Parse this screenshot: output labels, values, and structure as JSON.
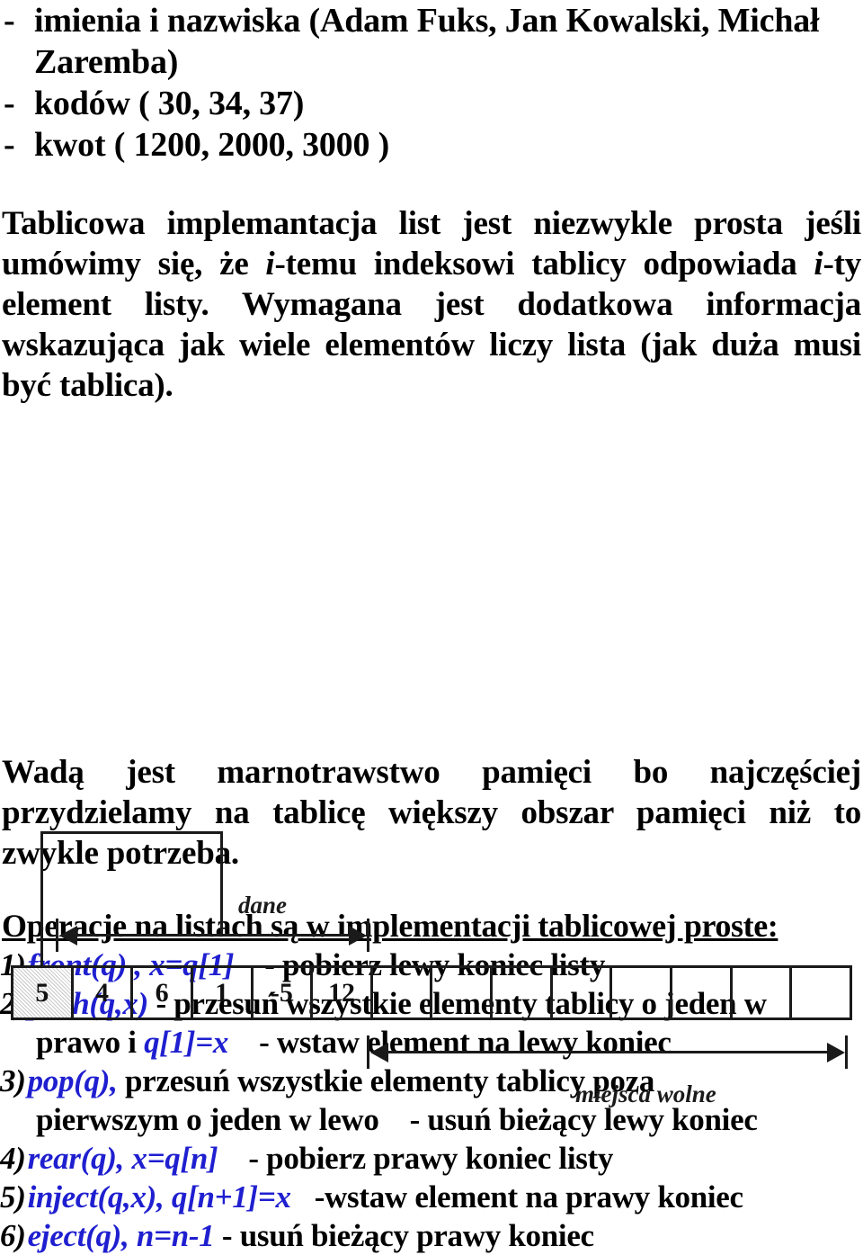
{
  "bullets": [
    {
      "dash": "-",
      "text": "imienia i nazwiska (Adam Fuks, Jan Kowalski, Michał Zaremba)"
    },
    {
      "dash": "-",
      "text": "kodów ( 30, 34, 37)"
    },
    {
      "dash": "-",
      "text": "kwot ( 1200, 2000, 3000 )"
    }
  ],
  "paragraphs": {
    "intro_part1": "Tablicowa implemantacja list jest niezwykle prosta jeśli umówimy się, że ",
    "intro_em1": "i",
    "intro_part2": "-temu indeksowi tablicy odpowiada ",
    "intro_em2": "i",
    "intro_part3": "-ty element listy. Wymagana jest dodatkowa informacja wskazująca jak wiele elementów liczy lista (jak duża musi być tablica).",
    "drawback": "Wadą jest marnotrawstwo pamięci bo najczęściej przydzielamy na tablicę większy obszar pamięci niż to zwykle potrzeba."
  },
  "figure": {
    "label_data": "dane",
    "label_free": "miejsca wolne",
    "cells": [
      {
        "value": "5",
        "shaded": true
      },
      {
        "value": "4",
        "shaded": false
      },
      {
        "value": "6",
        "shaded": false
      },
      {
        "value": "1",
        "shaded": false
      },
      {
        "value": "-5",
        "shaded": false
      },
      {
        "value": "12",
        "shaded": false
      },
      {
        "value": "",
        "shaded": false
      },
      {
        "value": "",
        "shaded": false
      },
      {
        "value": "",
        "shaded": false
      },
      {
        "value": "",
        "shaded": false
      },
      {
        "value": "",
        "shaded": false
      },
      {
        "value": "",
        "shaded": false
      },
      {
        "value": "",
        "shaded": false
      },
      {
        "value": "",
        "shaded": false
      }
    ]
  },
  "operations": {
    "title": "Operacje na listach są w implementacji tablicowej proste:",
    "accent_color": "#1f1fd0",
    "items": [
      {
        "num": "1)",
        "code": "front(q) , x=q[1]",
        "desc": "- pobierz lewy koniec listy",
        "cont_code": "",
        "cont_before": "",
        "cont_desc": ""
      },
      {
        "num": "2)",
        "code": "push(q,x)",
        "desc": "- przesuń wszystkie elementy tablicy o jeden w",
        "cont_before": "prawo i ",
        "cont_code": "q[1]=x",
        "cont_desc": "- wstaw element na lewy koniec"
      },
      {
        "num": "3)",
        "code": "pop(q),",
        "desc": "przesuń wszystkie elementy tablicy poza",
        "cont_before": "pierwszym o jeden w lewo",
        "cont_code": "",
        "cont_desc": "- usuń bieżący lewy koniec"
      },
      {
        "num": "4)",
        "code": "rear(q), x=q[n]",
        "desc": "- pobierz prawy koniec listy",
        "cont_before": "",
        "cont_code": "",
        "cont_desc": ""
      },
      {
        "num": "5)",
        "code": "inject(q,x), q[n+1]=x",
        "desc": "-wstaw element na prawy koniec",
        "cont_before": "",
        "cont_code": "",
        "cont_desc": ""
      },
      {
        "num": "6)",
        "code": "eject(q), n=n-1",
        "desc": "- usuń bieżący prawy koniec",
        "cont_before": "",
        "cont_code": "",
        "cont_desc": ""
      }
    ]
  }
}
